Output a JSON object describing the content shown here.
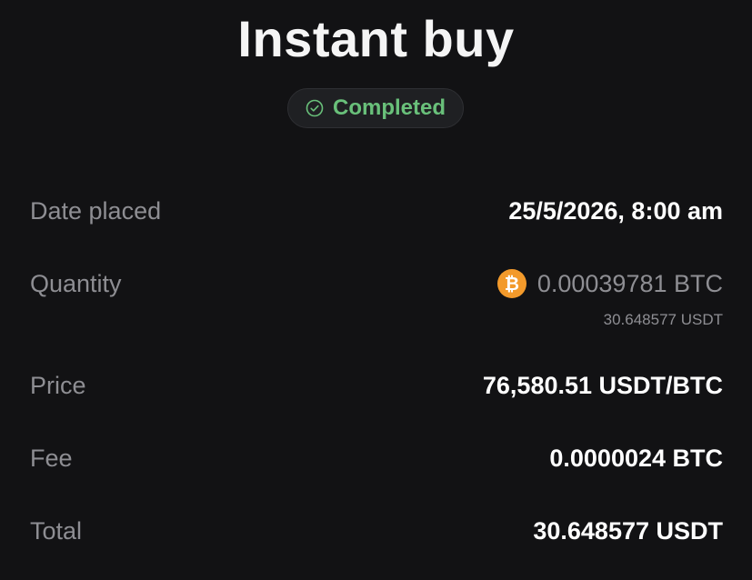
{
  "header": {
    "title": "Instant buy",
    "status": "Completed",
    "status_icon": "check-circle-icon",
    "status_color": "#69c07a"
  },
  "details": {
    "date_placed": {
      "label": "Date placed",
      "value": "25/5/2026, 8:00 am"
    },
    "quantity": {
      "label": "Quantity",
      "icon": "bitcoin-icon",
      "icon_color": "#f39a2b",
      "icon_glyph": "₿",
      "value": "0.00039781 BTC",
      "sub_value": "30.648577 USDT"
    },
    "price": {
      "label": "Price",
      "value": "76,580.51 USDT/BTC"
    },
    "fee": {
      "label": "Fee",
      "value": "0.0000024 BTC"
    },
    "total": {
      "label": "Total",
      "value": "30.648577 USDT"
    }
  },
  "colors": {
    "background": "#121214",
    "label": "#8e8e93",
    "value": "#ffffff"
  }
}
